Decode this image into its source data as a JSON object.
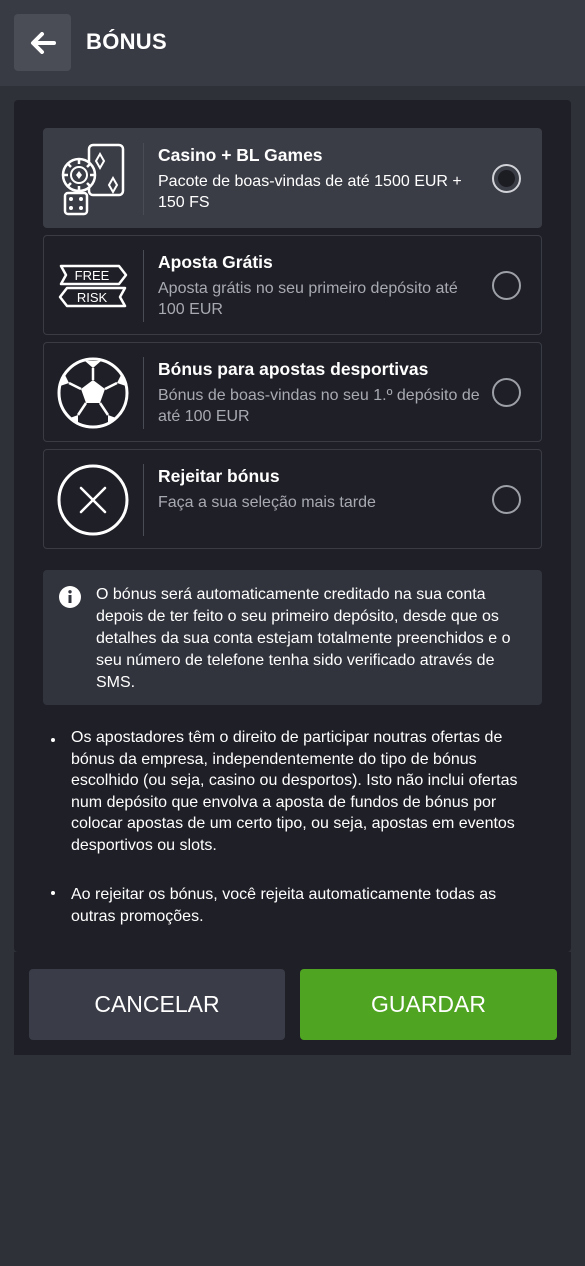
{
  "header": {
    "title": "BÓNUS",
    "back_icon": "arrow-left-icon"
  },
  "options": [
    {
      "title": "Casino + BL Games",
      "description": "Pacote de boas-vindas de até 1500 EUR + 150 FS",
      "icon": "casino-cards-dice-icon",
      "selected": true
    },
    {
      "title": "Aposta Grátis",
      "description": "Aposta grátis no seu primeiro depósito até 100 EUR",
      "icon": "free-risk-icon",
      "icon_text_top": "FREE",
      "icon_text_bottom": "RISK",
      "selected": false
    },
    {
      "title": "Bónus para apostas desportivas",
      "description": "Bónus de boas-vindas no seu 1.º depósito de até 100 EUR",
      "icon": "soccer-ball-icon",
      "selected": false
    },
    {
      "title": "Rejeitar bónus",
      "description": "Faça a sua seleção mais tarde",
      "icon": "reject-x-icon",
      "selected": false
    }
  ],
  "info": {
    "icon": "info-icon",
    "text": "O bónus será automaticamente creditado na sua conta depois de ter feito o seu primeiro depósito, desde que os detalhes da sua conta estejam totalmente preenchidos e o seu número de telefone tenha sido verificado através de SMS."
  },
  "rules": [
    "Os apostadores têm o direito de participar noutras ofertas de bónus da empresa, independentemente do tipo de bónus escolhido (ou seja, casino ou desportos). Isto não inclui ofertas num depósito que envolva a aposta de fundos de bónus por colocar apostas de um certo tipo, ou seja, apostas em eventos desportivos ou slots.",
    "Ao rejeitar os bónus, você rejeita automaticamente todas as outras promoções."
  ],
  "buttons": {
    "cancel": "CANCELAR",
    "save": "GUARDAR"
  },
  "colors": {
    "accent": "#4fa521",
    "panel": "#1f1f27",
    "background": "#2f3139",
    "selected_option": "#3b3d46"
  }
}
